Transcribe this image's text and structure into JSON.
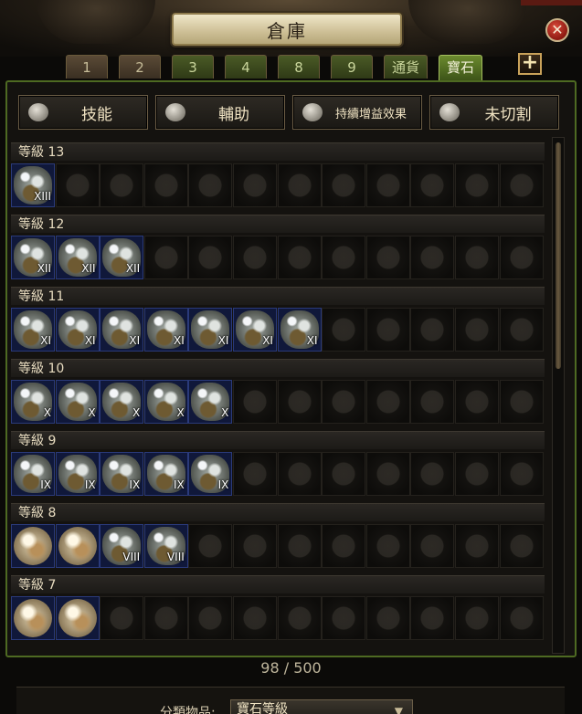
{
  "window": {
    "title": "倉庫",
    "close_glyph": "✕"
  },
  "tabs": [
    {
      "label": "1",
      "style": "brown"
    },
    {
      "label": "2",
      "style": "brown"
    },
    {
      "label": "3",
      "style": "green"
    },
    {
      "label": "4",
      "style": "green"
    },
    {
      "label": "8",
      "style": "green"
    },
    {
      "label": "9",
      "style": "green"
    },
    {
      "label": "通貨",
      "style": "green"
    },
    {
      "label": "寶石",
      "style": "active"
    }
  ],
  "add_tab_glyph": "+",
  "filters": [
    {
      "label": "技能",
      "icon": "skill-gem-icon"
    },
    {
      "label": "輔助",
      "icon": "support-gem-icon"
    },
    {
      "label": "持續增益效果",
      "icon": "buff-gem-icon"
    },
    {
      "label": "未切割",
      "icon": "uncut-gem-icon"
    }
  ],
  "levels": [
    {
      "label": "等級 13",
      "items": [
        {
          "type": "gem",
          "numeral": "XIII"
        }
      ]
    },
    {
      "label": "等級 12",
      "items": [
        {
          "type": "gem",
          "numeral": "XII"
        },
        {
          "type": "gem",
          "numeral": "XII"
        },
        {
          "type": "gem",
          "numeral": "XII"
        }
      ]
    },
    {
      "label": "等級 11",
      "items": [
        {
          "type": "gem",
          "numeral": "XI"
        },
        {
          "type": "gem",
          "numeral": "XI"
        },
        {
          "type": "gem",
          "numeral": "XI"
        },
        {
          "type": "gem",
          "numeral": "XI"
        },
        {
          "type": "gem",
          "numeral": "XI"
        },
        {
          "type": "gem",
          "numeral": "XI"
        },
        {
          "type": "gem",
          "numeral": "XI"
        }
      ]
    },
    {
      "label": "等級 10",
      "items": [
        {
          "type": "gem",
          "numeral": "X"
        },
        {
          "type": "gem",
          "numeral": "X"
        },
        {
          "type": "gem",
          "numeral": "X"
        },
        {
          "type": "gem",
          "numeral": "X"
        },
        {
          "type": "gem",
          "numeral": "X"
        }
      ]
    },
    {
      "label": "等級 9",
      "items": [
        {
          "type": "gem",
          "numeral": "IX"
        },
        {
          "type": "gem",
          "numeral": "IX"
        },
        {
          "type": "gem",
          "numeral": "IX"
        },
        {
          "type": "gem",
          "numeral": "IX"
        },
        {
          "type": "gem",
          "numeral": "IX"
        }
      ]
    },
    {
      "label": "等級 8",
      "items": [
        {
          "type": "orb",
          "numeral": ""
        },
        {
          "type": "orb",
          "numeral": ""
        },
        {
          "type": "gem",
          "numeral": "VIII"
        },
        {
          "type": "gem",
          "numeral": "VIII"
        }
      ]
    },
    {
      "label": "等級 7",
      "items": [
        {
          "type": "orb",
          "numeral": ""
        },
        {
          "type": "orb",
          "numeral": ""
        }
      ]
    }
  ],
  "slots_per_row": 12,
  "count": "98 / 500",
  "bottom": {
    "category_label": "分類物品:",
    "category_value": "寶石等級",
    "caret": "▼"
  }
}
